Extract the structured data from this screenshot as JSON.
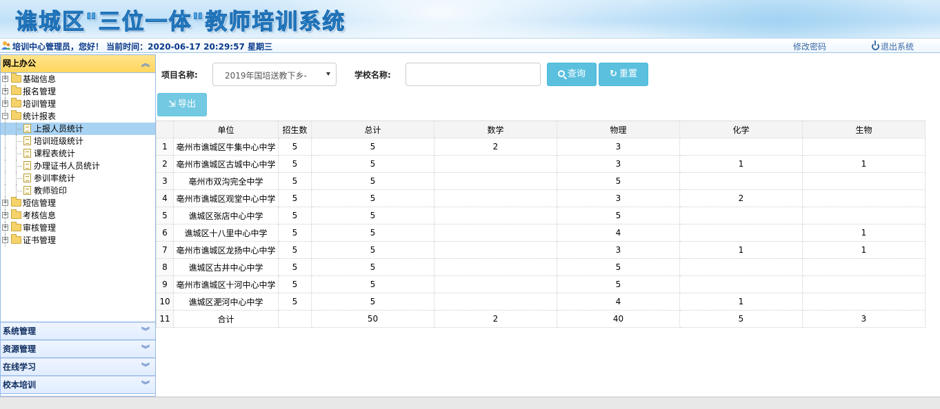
{
  "header": {
    "title": "谯城区\"三位一体\"教师培训系统"
  },
  "statusbar": {
    "greeting": "培训中心管理员，您好！ 当前时间：2020-06-17 20:29:57 星期三",
    "change_password": "修改密码",
    "logout": "退出系统"
  },
  "sidebar": {
    "office_title": "网上办公",
    "tree": [
      {
        "label": "基础信息",
        "type": "folder",
        "expanded": false
      },
      {
        "label": "报名管理",
        "type": "folder",
        "expanded": false
      },
      {
        "label": "培训管理",
        "type": "folder",
        "expanded": false
      },
      {
        "label": "统计报表",
        "type": "folder",
        "expanded": true
      },
      {
        "label": "上报人员统计",
        "type": "doc",
        "selected": true
      },
      {
        "label": "培训班级统计",
        "type": "doc"
      },
      {
        "label": "课程表统计",
        "type": "doc"
      },
      {
        "label": "办理证书人员统计",
        "type": "doc"
      },
      {
        "label": "参训率统计",
        "type": "doc"
      },
      {
        "label": "教师验印",
        "type": "doc"
      },
      {
        "label": "短信管理",
        "type": "folder",
        "expanded": false
      },
      {
        "label": "考核信息",
        "type": "folder",
        "expanded": false
      },
      {
        "label": "审核管理",
        "type": "folder",
        "expanded": false
      },
      {
        "label": "证书管理",
        "type": "folder",
        "expanded": false
      }
    ],
    "panels": [
      "系统管理",
      "资源管理",
      "在线学习",
      "校本培训"
    ]
  },
  "filters": {
    "project_label": "项目名称:",
    "project_value": "2019年国培送教下乡-",
    "school_label": "学校名称:",
    "school_value": "",
    "query_label": "查询",
    "reset_label": "重置",
    "export_label": "导出"
  },
  "table": {
    "columns": [
      "",
      "单位",
      "招生数",
      "总计",
      "数学",
      "物理",
      "化学",
      "生物"
    ],
    "rows": [
      [
        "1",
        "亳州市谯城区牛集中心中学",
        "5",
        "5",
        "2",
        "3",
        "",
        ""
      ],
      [
        "2",
        "亳州市谯城区古城中心中学",
        "5",
        "5",
        "",
        "3",
        "1",
        "1"
      ],
      [
        "3",
        "亳州市双沟完全中学",
        "5",
        "5",
        "",
        "5",
        "",
        ""
      ],
      [
        "4",
        "亳州市谯城区观堂中心中学",
        "5",
        "5",
        "",
        "3",
        "2",
        ""
      ],
      [
        "5",
        "谯城区张店中心中学",
        "5",
        "5",
        "",
        "5",
        "",
        ""
      ],
      [
        "6",
        "谯城区十八里中心中学",
        "5",
        "5",
        "",
        "4",
        "",
        "1"
      ],
      [
        "7",
        "亳州市谯城区龙扬中心中学",
        "5",
        "5",
        "",
        "3",
        "1",
        "1"
      ],
      [
        "8",
        "谯城区古井中心中学",
        "5",
        "5",
        "",
        "5",
        "",
        ""
      ],
      [
        "9",
        "亳州市谯城区十河中心中学",
        "5",
        "5",
        "",
        "5",
        "",
        ""
      ],
      [
        "10",
        "谯城区淝河中心中学",
        "5",
        "5",
        "",
        "4",
        "1",
        ""
      ],
      [
        "11",
        "合计",
        "",
        "50",
        "2",
        "40",
        "5",
        "3"
      ]
    ]
  }
}
